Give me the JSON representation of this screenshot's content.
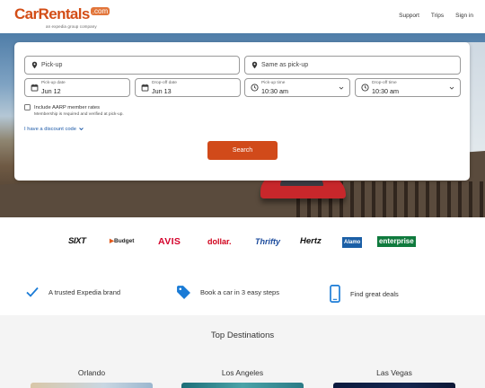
{
  "header": {
    "logo_main": "CarRentals",
    "logo_suffix": ".com",
    "logo_sub": "an expedia group company",
    "nav": [
      "Support",
      "Trips",
      "Sign in"
    ]
  },
  "search": {
    "pickup_placeholder": "Pick-up",
    "dropoff_placeholder": "Same as pick-up",
    "pickup_date_label": "Pick-up date",
    "pickup_date": "Jun 12",
    "dropoff_date_label": "Drop-off date",
    "dropoff_date": "Jun 13",
    "pickup_time_label": "Pick-up time",
    "pickup_time": "10:30 am",
    "dropoff_time_label": "Drop-off time",
    "dropoff_time": "10:30 am",
    "aarp_label": "Include AARP member rates",
    "aarp_note": "Membership is required and verified at pick-up.",
    "discount_link": "I have a discount code",
    "search_button": "Search"
  },
  "brands": [
    "SIXT",
    "Budget",
    "AVIS",
    "dollar.",
    "Thrifty",
    "Hertz",
    "Alamo",
    "enterprise"
  ],
  "features": [
    {
      "icon": "checkmark-icon",
      "text": "A trusted Expedia brand"
    },
    {
      "icon": "tag-icon",
      "text": "Book a car in 3 easy steps"
    },
    {
      "icon": "phone-icon",
      "text": "Find great deals"
    }
  ],
  "destinations": {
    "title": "Top Destinations",
    "cities": [
      "Orlando",
      "Los Angeles",
      "Las Vegas"
    ]
  },
  "colors": {
    "brand_orange": "#d34d16",
    "search_button": "#d14a1a",
    "link_blue": "#1d5aa8",
    "feature_icon_blue": "#1a7bd6"
  }
}
